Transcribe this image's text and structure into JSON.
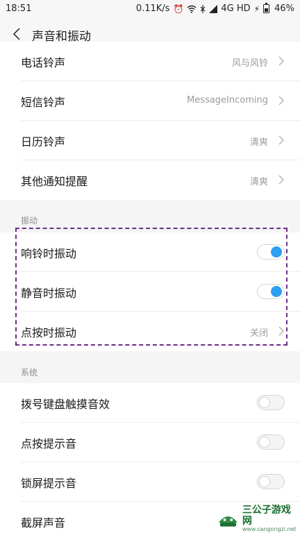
{
  "status_bar": {
    "time": "18:51",
    "speed": "0.11K/s",
    "network": "4G HD",
    "battery": "46%"
  },
  "header": {
    "title": "声音和振动"
  },
  "ringtones": [
    {
      "label": "电话铃声",
      "value": "风与风铃"
    },
    {
      "label": "短信铃声",
      "value": "MessageIncoming"
    },
    {
      "label": "日历铃声",
      "value": "清爽"
    },
    {
      "label": "其他通知提醒",
      "value": "清爽"
    }
  ],
  "vibration": {
    "section_title": "振动",
    "items": [
      {
        "label": "响铃时振动",
        "toggle": "on"
      },
      {
        "label": "静音时振动",
        "toggle": "on"
      },
      {
        "label": "点按时振动",
        "value": "关闭"
      }
    ]
  },
  "system": {
    "section_title": "系统",
    "items": [
      {
        "label": "拨号键盘触摸音效",
        "toggle": "off"
      },
      {
        "label": "点按提示音",
        "toggle": "off"
      },
      {
        "label": "锁屏提示音",
        "toggle": "off"
      },
      {
        "label": "截屏声音",
        "toggle": "off"
      }
    ]
  },
  "watermark": {
    "title": "三公子游戏网",
    "url": "www.sangongzi.net"
  },
  "colors": {
    "accent": "#2c9ff0",
    "highlight": "#6b2d87"
  }
}
